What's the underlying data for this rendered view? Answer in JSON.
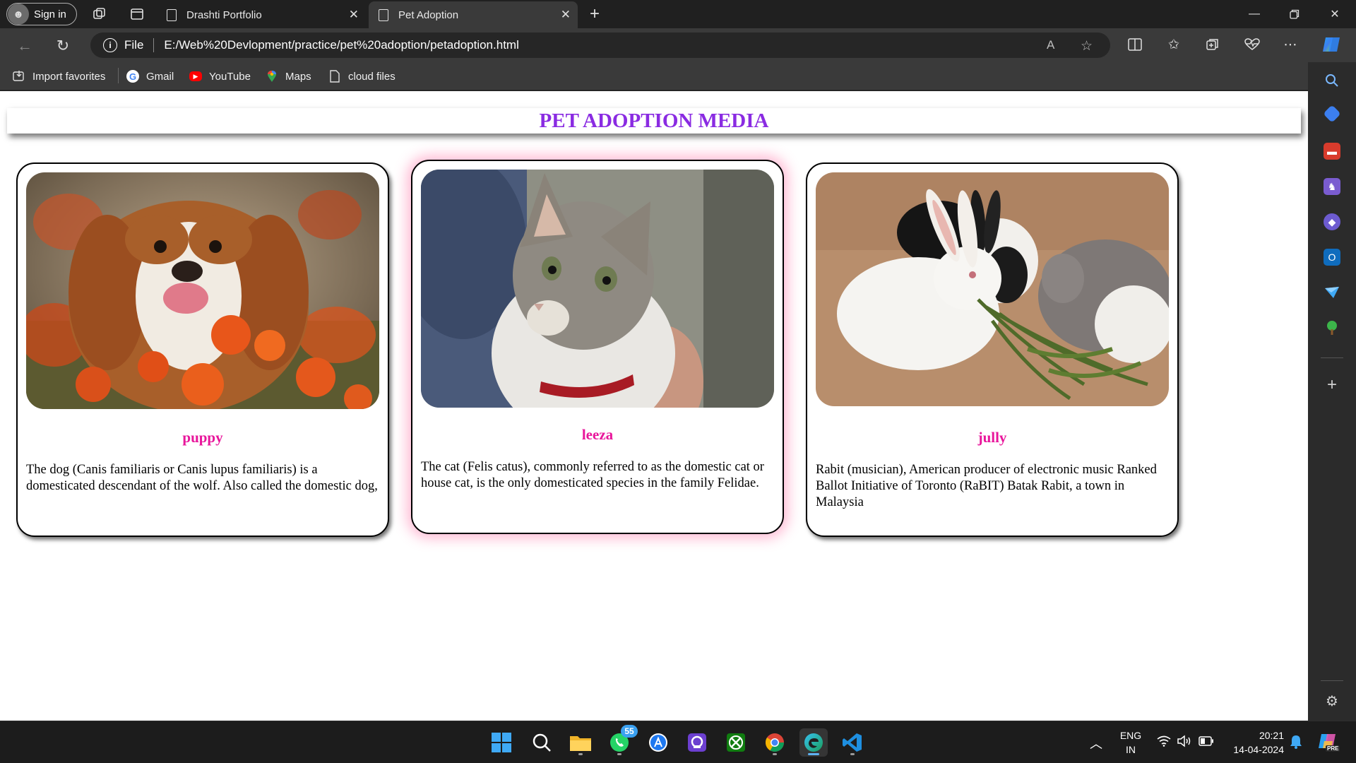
{
  "browser": {
    "signin_label": "Sign in",
    "tabs": [
      {
        "title": "Drashti Portfolio",
        "active": false
      },
      {
        "title": "Pet Adoption",
        "active": true
      }
    ],
    "url_scheme_label": "File",
    "url": "E:/Web%20Devlopment/practice/pet%20adoption/petadoption.html",
    "favorites": [
      {
        "label": "Import favorites",
        "icon": "import-icon"
      },
      {
        "label": "Gmail",
        "icon": "google-icon"
      },
      {
        "label": "YouTube",
        "icon": "youtube-icon"
      },
      {
        "label": "Maps",
        "icon": "maps-icon"
      },
      {
        "label": "cloud files",
        "icon": "file-icon"
      }
    ],
    "read_aloud_glyph": "A"
  },
  "page": {
    "title": "PET ADOPTION MEDIA",
    "title_color": "#8a2be2",
    "name_color": "#e8169b",
    "pets": [
      {
        "name": "puppy",
        "description": "The dog (Canis familiaris or Canis lupus familiaris) is a domesticated descendant of the wolf. Also called the domestic dog,",
        "image": "dog-photo"
      },
      {
        "name": "leeza",
        "description": "The cat (Felis catus), commonly referred to as the domestic cat or house cat, is the only domesticated species in the family Felidae.",
        "image": "cat-photo"
      },
      {
        "name": "jully",
        "description": "Rabit (musician), American producer of electronic music Ranked Ballot Initiative of Toronto (RaBIT) Batak Rabit, a town in Malaysia",
        "image": "rabbit-photo"
      }
    ]
  },
  "taskbar": {
    "whatsapp_badge": "55",
    "language_top": "ENG",
    "language_bottom": "IN",
    "time": "20:21",
    "date": "14-04-2024",
    "copilot_badge": "PRE"
  }
}
